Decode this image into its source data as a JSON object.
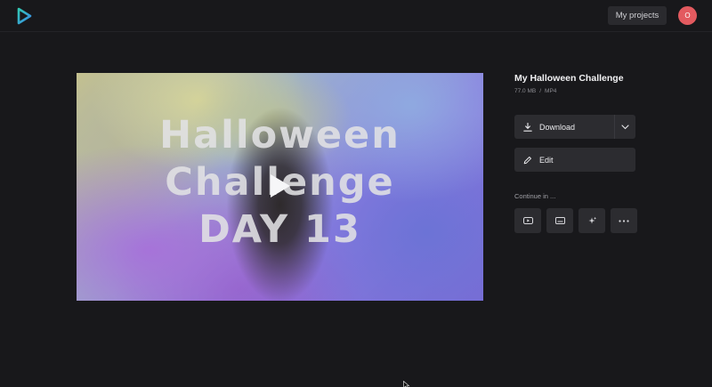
{
  "header": {
    "my_projects_label": "My projects",
    "avatar_initial": "O"
  },
  "video": {
    "title_lines": [
      "Halloween",
      "Challenge",
      "DAY 13"
    ]
  },
  "sidebar": {
    "title": "My Halloween Challenge",
    "size": "77.0 MB",
    "separator": "/",
    "format": "MP4",
    "download_label": "Download",
    "edit_label": "Edit",
    "continue_label": "Continue in ...",
    "continue_icons": [
      "youtube-icon",
      "captions-icon",
      "sparkle-icon",
      "more-icon"
    ]
  },
  "colors": {
    "background": "#18181b",
    "button": "#2c2c30",
    "avatar": "#e35a5f",
    "logo_blue": "#3aa8e8",
    "logo_teal": "#32c8b4"
  }
}
